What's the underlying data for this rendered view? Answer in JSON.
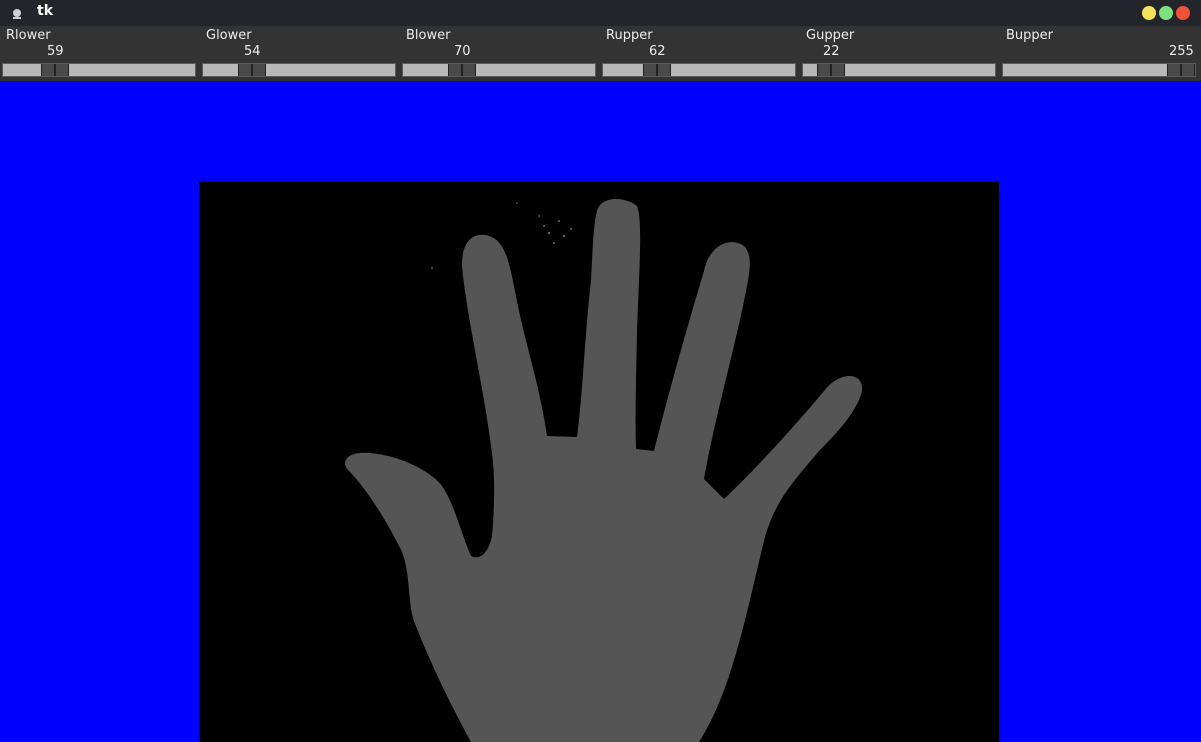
{
  "window": {
    "title": "tk",
    "buttons": [
      {
        "name": "minimize",
        "color": "#f5e35b"
      },
      {
        "name": "maximize",
        "color": "#7ee07e"
      },
      {
        "name": "close",
        "color": "#f1503a"
      }
    ]
  },
  "scales": [
    {
      "label": "Rlower",
      "value": "59",
      "fraction": 0.231
    },
    {
      "label": "Glower",
      "value": "54",
      "fraction": 0.212
    },
    {
      "label": "Blower",
      "value": "70",
      "fraction": 0.275
    },
    {
      "label": "Rupper",
      "value": "62",
      "fraction": 0.243
    },
    {
      "label": "Gupper",
      "value": "22",
      "fraction": 0.086
    },
    {
      "label": "Bupper",
      "value": "255",
      "fraction": 1.0
    }
  ],
  "canvas": {
    "background": "#0000ff",
    "mask_foreground": "#555555",
    "mask_background": "#000000",
    "content": "hand-mask-image"
  }
}
